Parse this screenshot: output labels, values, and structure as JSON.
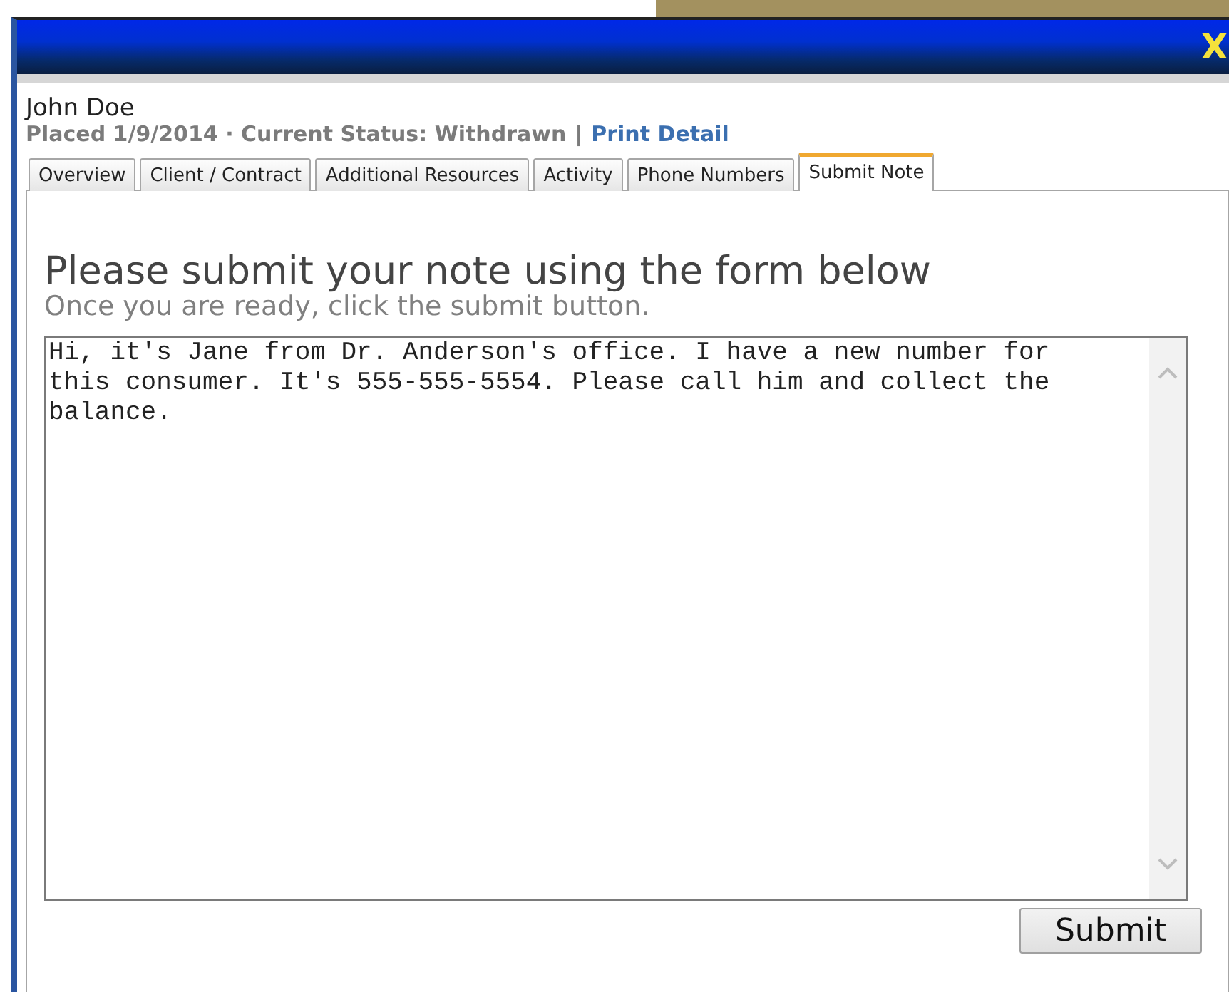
{
  "window": {
    "close_label": "X"
  },
  "record": {
    "name": "John Doe",
    "status_line": "Placed 1/9/2014 · Current Status: Withdrawn",
    "separator": "|",
    "link": "Print Detail"
  },
  "tabs": [
    {
      "label": "Overview",
      "selected": false
    },
    {
      "label": "Client / Contract",
      "selected": false
    },
    {
      "label": "Additional Resources",
      "selected": false
    },
    {
      "label": "Activity",
      "selected": false
    },
    {
      "label": "Phone Numbers",
      "selected": false
    },
    {
      "label": "Submit Note",
      "selected": true
    }
  ],
  "form": {
    "heading": "Please submit your note using the form below",
    "subheading": "Once you are ready, click the submit button.",
    "note": "Hi, it's Jane from Dr. Anderson's office. I have a new number for this consumer. It's 555-555-5554. Please call him and collect the balance.",
    "button": "Submit"
  }
}
